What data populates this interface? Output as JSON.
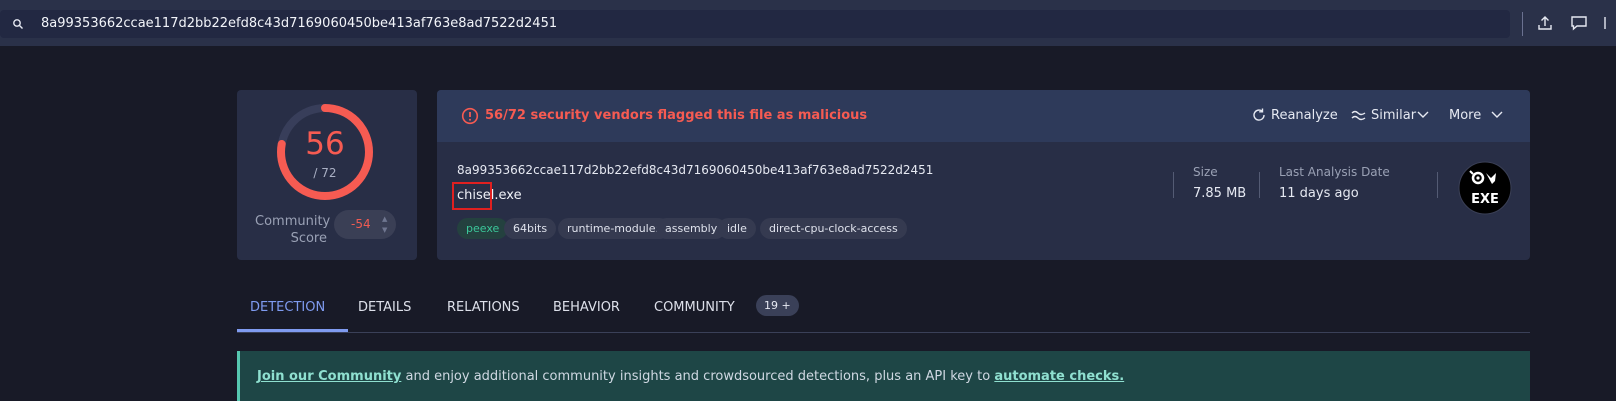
{
  "search": {
    "value": "8a99353662ccae117d2bb22efd8c43d7169060450be413af763e8ad7522d2451"
  },
  "toolbar": {
    "upload_icon": "upload-icon",
    "comment_icon": "comment-icon"
  },
  "score": {
    "value": "56",
    "total": "/ 72",
    "ratio": 0.778,
    "color": "#f65b52"
  },
  "community": {
    "label_line1": "Community",
    "label_line2": "Score",
    "value": "-54"
  },
  "alert": {
    "text": "56/72 security vendors flagged this file as malicious"
  },
  "actions": {
    "reanalyze": "Reanalyze",
    "similar": "Similar",
    "more": "More"
  },
  "file": {
    "hash": "8a99353662ccae117d2bb22efd8c43d7169060450be413af763e8ad7522d2451",
    "name": "chisel.exe",
    "tags": [
      "peexe",
      "64bits",
      "runtime-modules",
      "assembly",
      "idle",
      "direct-cpu-clock-access"
    ]
  },
  "meta": {
    "size_label": "Size",
    "size_value": "7.85 MB",
    "date_label": "Last Analysis Date",
    "date_value": "11 days ago"
  },
  "filetype_icon": {
    "text": "EXE"
  },
  "tabs": [
    "DETECTION",
    "DETAILS",
    "RELATIONS",
    "BEHAVIOR",
    "COMMUNITY"
  ],
  "community_badge": "19 +",
  "banner": {
    "link1": "Join our Community",
    "middle": " and enjoy additional community insights and crowdsourced detections, plus an API key to ",
    "link2": "automate checks."
  }
}
